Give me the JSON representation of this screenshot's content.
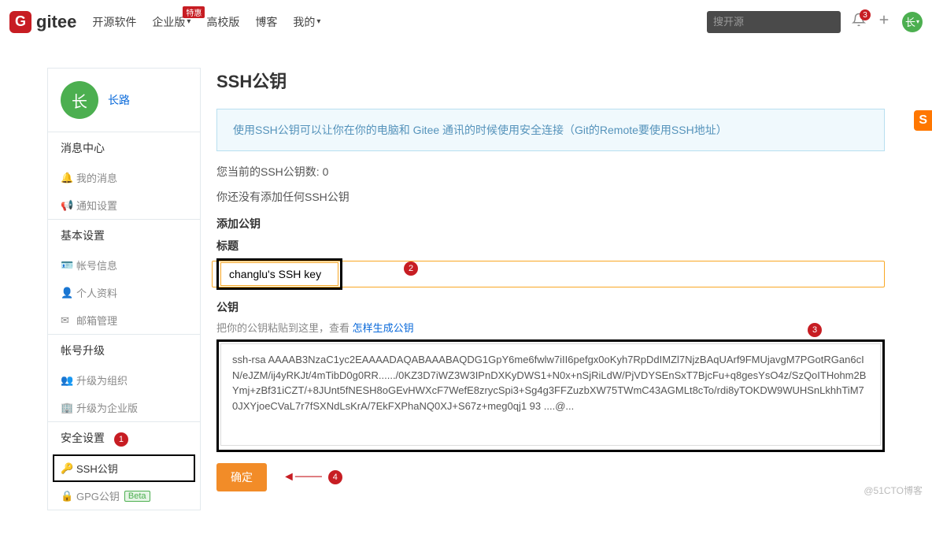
{
  "header": {
    "logo": "gitee",
    "nav": {
      "opensource": "开源软件",
      "enterprise": "企业版",
      "enterprise_badge": "特惠",
      "campus": "高校版",
      "blog": "博客",
      "mine": "我的"
    },
    "search_placeholder": "搜开源",
    "notif_count": "3",
    "avatar": "长"
  },
  "sidebar": {
    "avatar": "长",
    "username": "长路",
    "sections": {
      "message": "消息中心",
      "msg_items": {
        "mine": "我的消息",
        "settings": "通知设置"
      },
      "basic": "基本设置",
      "basic_items": {
        "account": "帐号信息",
        "profile": "个人资料",
        "email": "邮箱管理"
      },
      "upgrade": "帐号升级",
      "upgrade_items": {
        "org": "升级为组织",
        "enterprise": "升级为企业版"
      },
      "security": "安全设置",
      "security_items": {
        "ssh": "SSH公钥",
        "gpg": "GPG公钥",
        "gpg_badge": "Beta"
      }
    },
    "annotation_1": "1"
  },
  "main": {
    "title": "SSH公钥",
    "info_text": "使用SSH公钥可以让你在你的电脑和 Gitee 通讯的时候使用安全连接（Git的Remote要使用SSH地址）",
    "key_count": "您当前的SSH公钥数: 0",
    "no_key": "你还没有添加任何SSH公钥",
    "add_title": "添加公钥",
    "title_label": "标题",
    "title_value": "changlu's SSH key",
    "annotation_2": "2",
    "pubkey_label": "公钥",
    "pubkey_desc": "把你的公钥粘贴到这里，查看 ",
    "pubkey_link": "怎样生成公钥",
    "annotation_3": "3",
    "textarea_value": "ssh-rsa AAAAB3NzaC1yc2EAAAADAQABAAABAQDG1GpY6me6fwlw7iII6pefgx0oKyh7RpDdIMZl7NjzBAqUArf9FMUjavgM7PGotRGan6cIN/eJZM/ij4yRKJt/4mTibD0g0RR....../0KZ3D7iWZ3W3IPnDXKyDWS1+N0x+nSjRiLdW/PjVDYSEnSxT7BjcFu+q8gesYsO4z/SzQoITHohm2BYmj+zBf31iCZT/+8JUnt5fNESH8oGEvHWXcF7WefE8zrycSpi3+Sg4g3FFZuzbXW75TWmC43AGMLt8cTo/rdi8yTOKDW9WUHSnLkhhTiM70JXYjoeCVaL7r7fSXNdLsKrA/7EkFXPhaNQ0XJ+S67z+meg0qj1 93 ....@...",
    "submit": "确定",
    "annotation_4": "4"
  },
  "watermark": "@51CTO博客",
  "sogou": "S"
}
